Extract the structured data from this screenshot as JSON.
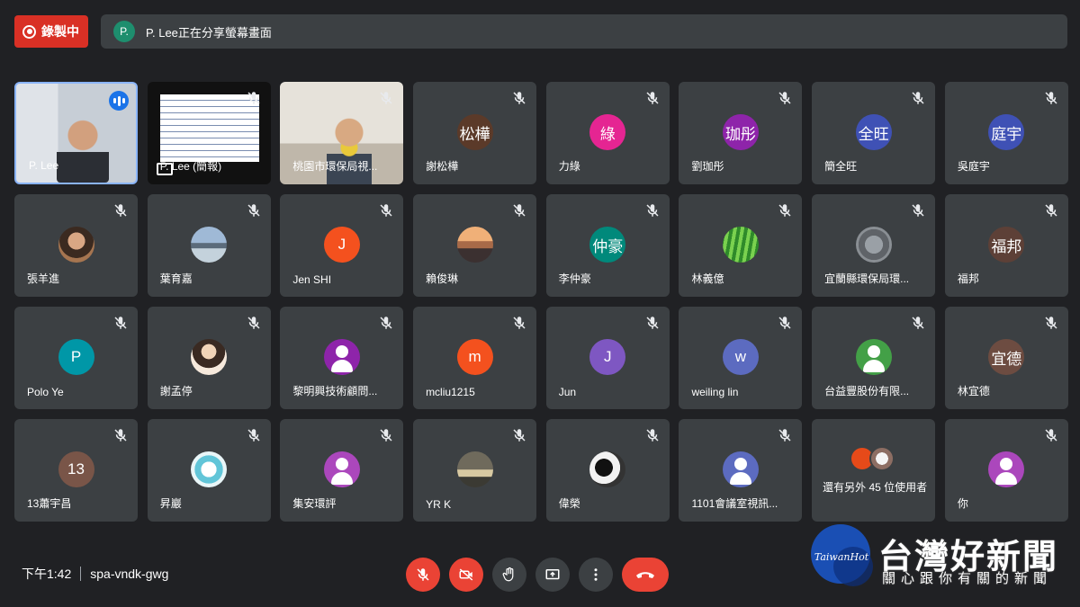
{
  "recording": {
    "label": "錄製中",
    "color": "#d93025"
  },
  "share_banner": {
    "avatar_letter": "P.",
    "text": "P. Lee正在分享螢幕畫面"
  },
  "tiles": [
    {
      "type": "video-lee",
      "name": "P. Lee",
      "speaking": true,
      "muted": false
    },
    {
      "type": "video-share",
      "name": "P. Lee (簡報)",
      "muted": true
    },
    {
      "type": "video-room",
      "name": "桃園市環保局視...",
      "muted": true
    },
    {
      "type": "avatar",
      "name": "謝松樺",
      "initials": "松樺",
      "color": "#5b3a29",
      "muted": true
    },
    {
      "type": "avatar",
      "name": "力綠",
      "initials": "綠",
      "color": "#e52592",
      "muted": true
    },
    {
      "type": "avatar",
      "name": "劉珈彤",
      "initials": "珈彤",
      "color": "#8e24aa",
      "muted": true
    },
    {
      "type": "avatar",
      "name": "簡全旺",
      "initials": "全旺",
      "color": "#3f51b5",
      "muted": true
    },
    {
      "type": "avatar",
      "name": "吳庭宇",
      "initials": "庭宇",
      "color": "#3f51b5",
      "muted": true
    },
    {
      "type": "photo",
      "photo": "photo-a",
      "name": "張羊進",
      "muted": true
    },
    {
      "type": "photo",
      "photo": "photo-b",
      "name": "葉育嘉",
      "muted": true
    },
    {
      "type": "avatar",
      "name": "Jen SHI",
      "initials": "J",
      "color": "#f4511e",
      "muted": true
    },
    {
      "type": "photo",
      "photo": "photo-c",
      "name": "賴俊琳",
      "muted": true
    },
    {
      "type": "avatar",
      "name": "李仲豪",
      "initials": "仲豪",
      "color": "#00897b",
      "muted": true
    },
    {
      "type": "photo",
      "photo": "photo-d",
      "name": "林義億",
      "muted": true
    },
    {
      "type": "photo",
      "photo": "photo-e",
      "name": "宜蘭縣環保局環...",
      "muted": true
    },
    {
      "type": "avatar",
      "name": "福邦",
      "initials": "福邦",
      "color": "#5d4037",
      "muted": true
    },
    {
      "type": "avatar",
      "name": "Polo Ye",
      "initials": "P",
      "color": "#0097a7",
      "muted": true
    },
    {
      "type": "photo",
      "photo": "photo-f",
      "name": "謝孟停",
      "muted": true
    },
    {
      "type": "person",
      "name": "黎明興技術顧問...",
      "color": "#8e24aa",
      "muted": true
    },
    {
      "type": "avatar",
      "name": "mcliu1215",
      "initials": "m",
      "color": "#f4511e",
      "muted": true
    },
    {
      "type": "avatar",
      "name": "Jun",
      "initials": "J",
      "color": "#7e57c2",
      "muted": true
    },
    {
      "type": "avatar",
      "name": "weiling lin",
      "initials": "w",
      "color": "#5c6bc0",
      "muted": true
    },
    {
      "type": "person",
      "name": "台益豐股份有限...",
      "color": "#43a047",
      "muted": true
    },
    {
      "type": "avatar",
      "name": "林宜德",
      "initials": "宜德",
      "color": "#6d4c41",
      "muted": true
    },
    {
      "type": "avatar",
      "name": "13蕭宇昌",
      "initials": "13",
      "color": "#795548",
      "muted": true
    },
    {
      "type": "photo",
      "photo": "photo-g",
      "name": "昇巖",
      "muted": true
    },
    {
      "type": "person",
      "name": "集安環評",
      "color": "#ab47bc",
      "muted": true
    },
    {
      "type": "photo",
      "photo": "photo-h",
      "name": "YR K",
      "muted": true
    },
    {
      "type": "photo",
      "photo": "photo-i",
      "name": "偉榮",
      "muted": true
    },
    {
      "type": "person",
      "name": "1101會議室視訊...",
      "color": "#5c6bc0",
      "muted": true
    },
    {
      "type": "others",
      "name": "還有另外 45 位使用者",
      "muted": false
    },
    {
      "type": "person",
      "name": "你",
      "color": "#ab47bc",
      "muted": true
    }
  ],
  "meeting": {
    "time": "下午1:42",
    "code": "spa-vndk-gwg"
  },
  "controls": {
    "mic": "mic-off-icon",
    "camera": "camera-off-icon",
    "hand": "raise-hand-icon",
    "present": "present-screen-icon",
    "more": "more-options-icon",
    "hangup": "hang-up-icon"
  },
  "watermark": {
    "title": "台灣好新聞",
    "subtitle": "關心跟你有關的新聞",
    "logo_text": "TaiwanHot"
  }
}
